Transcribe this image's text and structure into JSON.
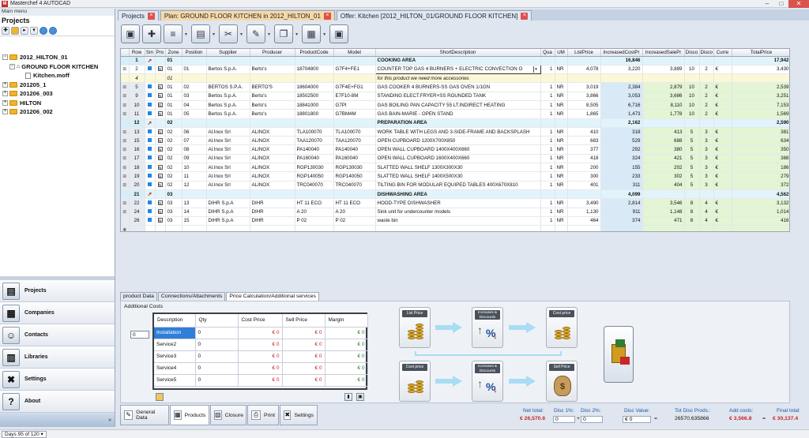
{
  "window": {
    "title": "Masterchef 4 AUTOCAD",
    "icon_letter": "M",
    "btn_min": "–",
    "btn_max": "□",
    "btn_close": "✕"
  },
  "left": {
    "main_menu_label": "Main menu",
    "projects_header": "Projects",
    "tree": [
      {
        "label": "2012_HILTON_01",
        "expander": "−"
      },
      {
        "label": "GROUND FLOOR KITCHEN",
        "expander": "−"
      },
      {
        "label": "Kitchen.moff",
        "expander": ""
      },
      {
        "label": "201205_1",
        "expander": "+"
      },
      {
        "label": "201206_003",
        "expander": "+"
      },
      {
        "label": "HILTON",
        "expander": "+"
      },
      {
        "label": "201206_002",
        "expander": "+"
      }
    ],
    "nav": [
      {
        "label": "Projects",
        "icon": "▤"
      },
      {
        "label": "Companies",
        "icon": "▦"
      },
      {
        "label": "Contacts",
        "icon": "☺"
      },
      {
        "label": "Libraries",
        "icon": "▥"
      },
      {
        "label": "Settings",
        "icon": "✖"
      },
      {
        "label": "About",
        "icon": "?"
      }
    ],
    "nav_bottom_arrow": "»"
  },
  "status": {
    "days": "Days 95 of 120",
    "dd": "▾"
  },
  "tabs": [
    {
      "label": "Projects",
      "active": false,
      "closable": true
    },
    {
      "label": "Plan: GROUND FLOOR KITCHEN in 2012_HILTON_01",
      "active": true,
      "closable": true
    },
    {
      "label": "Offer: Kitchen [2012_HILTON_01/GROUND FLOOR KITCHEN]",
      "active": false,
      "closable": true
    }
  ],
  "tab_close_glyph": "×",
  "toolbar": {
    "buttons": [
      {
        "name": "save-icon",
        "glyph": "▣",
        "dd": false
      },
      {
        "name": "add-row-icon",
        "glyph": "✚",
        "dd": false
      },
      {
        "name": "database-icon",
        "glyph": "≡",
        "dd": true
      },
      {
        "name": "paste-icon",
        "glyph": "▤",
        "dd": true
      },
      {
        "name": "tools-icon",
        "glyph": "✂",
        "dd": true
      },
      {
        "name": "draw-icon",
        "glyph": "✎",
        "dd": true
      },
      {
        "name": "copy-icon",
        "glyph": "❐",
        "dd": true
      },
      {
        "name": "table-icon",
        "glyph": "▦",
        "dd": true
      },
      {
        "name": "disk-icon",
        "glyph": "▣",
        "dd": false
      }
    ],
    "dd_glyph": "▾"
  },
  "grid": {
    "columns": [
      "",
      "Row",
      "Sm",
      "Pro",
      "Zone",
      "Position",
      "Supplier",
      "Producer",
      "ProductCode",
      "Model",
      "ShortDescription",
      "Qua",
      "UM",
      "ListPrice",
      "IncreasedCostPr",
      "IncreasedSalePr",
      "Disco",
      "Disco",
      "Curre",
      "TotalPrice"
    ],
    "rows": [
      {
        "type": "group",
        "gut": "",
        "row": "1",
        "sm": "pin",
        "pro": "",
        "zone": "01",
        "pos": "",
        "sup": "",
        "prod": "",
        "code": "",
        "model": "",
        "desc": "COOKING AREA",
        "qty": "",
        "um": "",
        "list": "",
        "icp": "16,846",
        "isp": "",
        "d1": "",
        "d2": "",
        "cur": "",
        "tot": "17,942"
      },
      {
        "type": "sel",
        "gut": "⊞",
        "row": "2",
        "sm": "sq",
        "pro": "N",
        "zone": "01",
        "pos": "01",
        "sup": "Bertos S.p.A.",
        "prod": "Berto's",
        "code": "18704800",
        "model": "G7F4+FE1",
        "desc": "COUNTER TOP GAS 4 BURNERS + ELECTRIC CONVECTION O",
        "qty": "1",
        "um": "NR",
        "list": "4,078",
        "icp": "3,220",
        "isp": "3,889",
        "d1": "10",
        "d2": "2",
        "cur": "€",
        "tot": "3,430"
      },
      {
        "type": "note",
        "gut": "",
        "row": "4",
        "sm": "",
        "pro": "",
        "zone": "01",
        "pos": "",
        "sup": "",
        "prod": "",
        "code": "",
        "model": "",
        "desc": "for this product we need more accessories",
        "qty": "",
        "um": "",
        "list": "",
        "icp": "",
        "isp": "",
        "d1": "",
        "d2": "",
        "cur": "",
        "tot": ""
      },
      {
        "type": "item",
        "gut": "⊞",
        "row": "5",
        "sm": "sq",
        "pro": "N",
        "zone": "01",
        "pos": "02",
        "sup": "BERTOS S.P.A.",
        "prod": "BERTO'S",
        "code": "18604000",
        "model": "G7F4E+FG1",
        "desc": "GAS COOKER 4 BURNERS-SS GAS OVEN 1/1GN",
        "qty": "1",
        "um": "NR",
        "list": "3,019",
        "icp": "2,384",
        "isp": "2,879",
        "d1": "10",
        "d2": "2",
        "cur": "€",
        "tot": "2,539"
      },
      {
        "type": "item",
        "gut": "⊞",
        "row": "9",
        "sm": "sq",
        "pro": "N",
        "zone": "01",
        "pos": "03",
        "sup": "Bertos S.p.A.",
        "prod": "Berto's",
        "code": "18502500",
        "model": "E7F10-8M",
        "desc": "STANDING ELECT.FRYER+SS ROUNDED TANK",
        "qty": "1",
        "um": "NR",
        "list": "3,866",
        "icp": "3,053",
        "isp": "3,686",
        "d1": "10",
        "d2": "2",
        "cur": "€",
        "tot": "3,251"
      },
      {
        "type": "item",
        "gut": "⊞",
        "row": "10",
        "sm": "sq",
        "pro": "N",
        "zone": "01",
        "pos": "04",
        "sup": "Bertos S.p.A.",
        "prod": "Berto's",
        "code": "18841000",
        "model": "G7PI",
        "desc": "GAS BOILING PAN CAPACITY 55 LT.INDIRECT HEATING",
        "qty": "1",
        "um": "NR",
        "list": "8,505",
        "icp": "6,716",
        "isp": "8,110",
        "d1": "10",
        "d2": "2",
        "cur": "€",
        "tot": "7,153"
      },
      {
        "type": "item",
        "gut": "⊞",
        "row": "11",
        "sm": "sq",
        "pro": "N",
        "zone": "01",
        "pos": "05",
        "sup": "Bertos S.p.A.",
        "prod": "Berto's",
        "code": "18801800",
        "model": "G7BM4M",
        "desc": "GAS BAIN-MARIE - OPEN STAND",
        "qty": "1",
        "um": "NR",
        "list": "1,865",
        "icp": "1,473",
        "isp": "1,778",
        "d1": "10",
        "d2": "2",
        "cur": "€",
        "tot": "1,569"
      },
      {
        "type": "group",
        "gut": "",
        "row": "12",
        "sm": "pin",
        "pro": "",
        "zone": "02",
        "pos": "",
        "sup": "",
        "prod": "",
        "code": "",
        "model": "",
        "desc": "PREPARATION AREA",
        "qty": "",
        "um": "",
        "list": "",
        "icp": "2,162",
        "isp": "",
        "d1": "",
        "d2": "",
        "cur": "",
        "tot": "2,590"
      },
      {
        "type": "item",
        "gut": "⊞",
        "row": "13",
        "sm": "sq",
        "pro": "N",
        "zone": "02",
        "pos": "06",
        "sup": "Al.Inox Srl",
        "prod": "ALINOX",
        "code": "TLA100070",
        "model": "TLA100070",
        "desc": "WORK TABLE WITH LEGS AND 3-SIDE-FRAME AND BACKSPLASH",
        "qty": "1",
        "um": "NR",
        "list": "410",
        "icp": "318",
        "isp": "413",
        "d1": "5",
        "d2": "3",
        "cur": "€",
        "tot": "381"
      },
      {
        "type": "item",
        "gut": "⊞",
        "row": "15",
        "sm": "sq",
        "pro": "N",
        "zone": "02",
        "pos": "07",
        "sup": "Al.Inox Srl",
        "prod": "ALINOX",
        "code": "TAA120070",
        "model": "TAA120070",
        "desc": "OPEN CUPBOARD  1200X700X850",
        "qty": "1",
        "um": "NR",
        "list": "683",
        "icp": "529",
        "isp": "688",
        "d1": "5",
        "d2": "3",
        "cur": "€",
        "tot": "634"
      },
      {
        "type": "item",
        "gut": "⊞",
        "row": "16",
        "sm": "sq",
        "pro": "N",
        "zone": "02",
        "pos": "08",
        "sup": "Al.Inox Srl",
        "prod": "ALINOX",
        "code": "PA140040",
        "model": "PA140040",
        "desc": "OPEN WALL CUPBOARD 1400X400X660",
        "qty": "1",
        "um": "NR",
        "list": "377",
        "icp": "292",
        "isp": "380",
        "d1": "5",
        "d2": "3",
        "cur": "€",
        "tot": "350"
      },
      {
        "type": "item",
        "gut": "⊞",
        "row": "17",
        "sm": "sq",
        "pro": "N",
        "zone": "02",
        "pos": "09",
        "sup": "Al.Inox Srl",
        "prod": "ALINOX",
        "code": "PA160040",
        "model": "PA160040",
        "desc": "OPEN WALL CUPBOARD 1600X400X660",
        "qty": "1",
        "um": "NR",
        "list": "418",
        "icp": "324",
        "isp": "421",
        "d1": "5",
        "d2": "3",
        "cur": "€",
        "tot": "388"
      },
      {
        "type": "item",
        "gut": "⊞",
        "row": "18",
        "sm": "sq",
        "pro": "N",
        "zone": "02",
        "pos": "10",
        "sup": "Al.Inox Srl",
        "prod": "ALINOX",
        "code": "RGP130030",
        "model": "RGP130030",
        "desc": "SLATTED WALL SHELF  1300X300X30",
        "qty": "1",
        "um": "NR",
        "list": "200",
        "icp": "155",
        "isp": "202",
        "d1": "5",
        "d2": "3",
        "cur": "€",
        "tot": "186"
      },
      {
        "type": "item",
        "gut": "⊞",
        "row": "19",
        "sm": "sq",
        "pro": "N",
        "zone": "02",
        "pos": "11",
        "sup": "Al.Inox Srl",
        "prod": "ALINOX",
        "code": "RGP140050",
        "model": "RGP140050",
        "desc": "SLATTED WALL SHELF  1400X500X30",
        "qty": "1",
        "um": "NR",
        "list": "300",
        "icp": "233",
        "isp": "302",
        "d1": "5",
        "d2": "3",
        "cur": "€",
        "tot": "279"
      },
      {
        "type": "item",
        "gut": "⊞",
        "row": "20",
        "sm": "sq",
        "pro": "N",
        "zone": "02",
        "pos": "12",
        "sup": "Al.Inox Srl",
        "prod": "ALINOX",
        "code": "TRC040070",
        "model": "TRC040070",
        "desc": "TILTING BIN FOR MODULAR EQUIPED TABLES 400X670X810",
        "qty": "1",
        "um": "NR",
        "list": "401",
        "icp": "311",
        "isp": "404",
        "d1": "5",
        "d2": "3",
        "cur": "€",
        "tot": "372"
      },
      {
        "type": "group",
        "gut": "",
        "row": "21",
        "sm": "pin",
        "pro": "",
        "zone": "03",
        "pos": "",
        "sup": "",
        "prod": "",
        "code": "",
        "model": "",
        "desc": "DISHWASHING AREA",
        "qty": "",
        "um": "",
        "list": "",
        "icp": "4,099",
        "isp": "",
        "d1": "",
        "d2": "",
        "cur": "",
        "tot": "4,562"
      },
      {
        "type": "item",
        "gut": "⊞",
        "row": "22",
        "sm": "sq",
        "pro": "N",
        "zone": "03",
        "pos": "13",
        "sup": "DIHR S.p.A",
        "prod": "DIHR",
        "code": "HT 11 ECO",
        "model": "HT 11 ECO",
        "desc": "HOOD-TYPE DISHWASHER",
        "qty": "1",
        "um": "NR",
        "list": "3,490",
        "icp": "2,814",
        "isp": "3,546",
        "d1": "8",
        "d2": "4",
        "cur": "€",
        "tot": "3,132"
      },
      {
        "type": "item",
        "gut": "⊞",
        "row": "24",
        "sm": "sq",
        "pro": "N",
        "zone": "03",
        "pos": "14",
        "sup": "DIHR S.p.A",
        "prod": "DIHR",
        "code": "A 20",
        "model": "A 20",
        "desc": "Sink unit for undercounter models",
        "qty": "1",
        "um": "NR",
        "list": "1,130",
        "icp": "911",
        "isp": "1,148",
        "d1": "8",
        "d2": "4",
        "cur": "€",
        "tot": "1,014"
      },
      {
        "type": "item",
        "gut": "",
        "row": "26",
        "sm": "sq",
        "pro": "N",
        "zone": "03",
        "pos": "15",
        "sup": "DIHR S.p.A",
        "prod": "DIHR",
        "code": "P 02",
        "model": "P 02",
        "desc": "waste bin",
        "qty": "1",
        "um": "NR",
        "list": "464",
        "icp": "374",
        "isp": "471",
        "d1": "8",
        "d2": "4",
        "cur": "€",
        "tot": "416"
      },
      {
        "type": "new",
        "gut": "✱",
        "row": "",
        "sm": "",
        "pro": "",
        "zone": "",
        "pos": "",
        "sup": "",
        "prod": "",
        "code": "",
        "model": "",
        "desc": "",
        "qty": "",
        "um": "",
        "list": "",
        "icp": "",
        "isp": "",
        "d1": "",
        "d2": "",
        "cur": "",
        "tot": ""
      }
    ]
  },
  "lower_tabs": [
    "product Data",
    "Connections/Attachments",
    "Price Calculation/Additional services"
  ],
  "additional_costs": {
    "label": "Additional Costs",
    "qty_value": "0",
    "columns": [
      "Description",
      "Qty",
      "Cost Price",
      "Sell Price",
      "Margin"
    ],
    "rows": [
      {
        "desc": "Installation",
        "qty": "0",
        "cost": "€ 0",
        "sell": "€ 0",
        "margin": "€ 0"
      },
      {
        "desc": "Service2",
        "qty": "0",
        "cost": "€ 0",
        "sell": "€ 0",
        "margin": "€ 0"
      },
      {
        "desc": "Service3",
        "qty": "0",
        "cost": "€ 0",
        "sell": "€ 0",
        "margin": "€ 0"
      },
      {
        "desc": "Service4",
        "qty": "0",
        "cost": "€ 0",
        "sell": "€ 0",
        "margin": "€ 0"
      },
      {
        "desc": "Service5",
        "qty": "0",
        "cost": "€ 0",
        "sell": "€ 0",
        "margin": "€ 0"
      }
    ]
  },
  "flow": {
    "list_price": "List Price",
    "increases_discounts": "Increases & Discounts",
    "cost_price": "Cost price",
    "sell_price": "Sell Price",
    "percent": "%",
    "dollar": "$"
  },
  "footer_tabs": [
    {
      "label": "General Data",
      "icon": "✎"
    },
    {
      "label": "Products",
      "icon": "▦"
    },
    {
      "label": "Closure",
      "icon": "▧"
    },
    {
      "label": "Print",
      "icon": "⎙"
    },
    {
      "label": "Settings",
      "icon": "✖"
    }
  ],
  "totals": {
    "net_total_label": "Net total:",
    "net_total": "€ 26,570.6",
    "disc1_label": "Disc 1%:",
    "disc1": "0",
    "disc2_label": "Disc 2%:",
    "disc2": "0",
    "disc_value_label": "Disc Value:",
    "disc_value": "€ 0",
    "tot_disc_label": "Tot Disc Prods.:",
    "tot_disc": "26570.635866",
    "add_costs_label": "Add costs:",
    "add_costs": "€ 3,566.8",
    "final_total_label": "Final total:",
    "final_total": "€ 30,137.4",
    "plus": "+",
    "eq": "=",
    "eq2": "="
  },
  "colors": {
    "accent_tab": "#f7d9a6",
    "group_row": "#e1f4fb",
    "increased_cost_col": "#d8e9f7",
    "sale_total_col": "#e3f5d3",
    "red_value": "#c62828",
    "selection_blue": "#2f7fd8"
  }
}
